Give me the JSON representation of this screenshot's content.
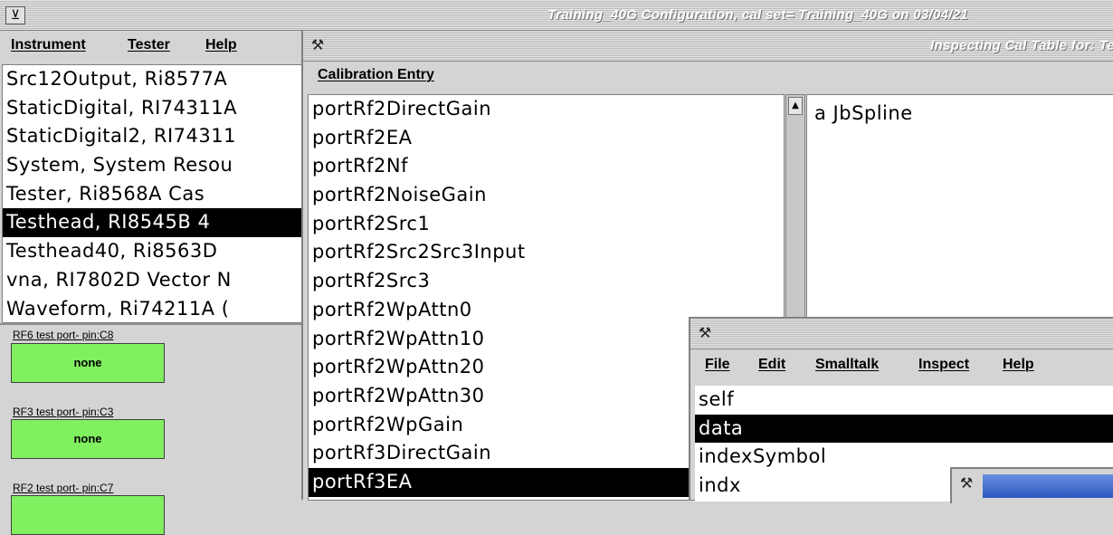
{
  "main_window": {
    "title": "Training_40G Configuration,  cal set= Training_40G on 03/04/21",
    "menu": [
      "Instrument",
      "Tester",
      "Help"
    ],
    "instruments": [
      {
        "text": "Src12Output,  Ri8577A",
        "selected": false
      },
      {
        "text": "StaticDigital,  RI74311A",
        "selected": false
      },
      {
        "text": "StaticDigital2,  RI74311",
        "selected": false
      },
      {
        "text": "System,  System Resou",
        "selected": false
      },
      {
        "text": "Tester,  Ri8568A   Cas",
        "selected": false
      },
      {
        "text": "Testhead,  RI8545B   4",
        "selected": true
      },
      {
        "text": "Testhead40,  Ri8563D",
        "selected": false
      },
      {
        "text": "vna,  RI7802D Vector N",
        "selected": false
      },
      {
        "text": "Waveform,  Ri74211A (",
        "selected": false
      }
    ],
    "ports": [
      {
        "label": "RF6 test port- pin:C8",
        "value": "none"
      },
      {
        "label": "RF3 test port- pin:C3",
        "value": "none"
      },
      {
        "label": "RF2 test port- pin:C7",
        "value": ""
      }
    ]
  },
  "cal_window": {
    "title": "Inspecting Cal Table for: Te",
    "menu": [
      "Calibration Entry"
    ],
    "entries": [
      {
        "text": "portRf2DirectGain",
        "selected": false
      },
      {
        "text": "portRf2EA",
        "selected": false
      },
      {
        "text": "portRf2Nf",
        "selected": false
      },
      {
        "text": "portRf2NoiseGain",
        "selected": false
      },
      {
        "text": "portRf2Src1",
        "selected": false
      },
      {
        "text": "portRf2Src2Src3Input",
        "selected": false
      },
      {
        "text": "portRf2Src3",
        "selected": false
      },
      {
        "text": "portRf2WpAttn0",
        "selected": false
      },
      {
        "text": "portRf2WpAttn10",
        "selected": false
      },
      {
        "text": "portRf2WpAttn20",
        "selected": false
      },
      {
        "text": "portRf2WpAttn30",
        "selected": false
      },
      {
        "text": "portRf2WpGain",
        "selected": false
      },
      {
        "text": "portRf3DirectGain",
        "selected": false
      },
      {
        "text": "portRf3EA",
        "selected": true
      }
    ],
    "detail_text": "a JbSpline"
  },
  "inspector_window": {
    "menu": [
      "File",
      "Edit",
      "Smalltalk",
      "Inspect",
      "Help"
    ],
    "fields": [
      {
        "text": "self",
        "selected": false
      },
      {
        "text": "data",
        "selected": true
      },
      {
        "text": "indexSymbol",
        "selected": false
      },
      {
        "text": "indx",
        "selected": false
      }
    ]
  },
  "colors": {
    "port_fill": "#80f060",
    "selection": "#000000",
    "mini_title": "#3060c8"
  }
}
